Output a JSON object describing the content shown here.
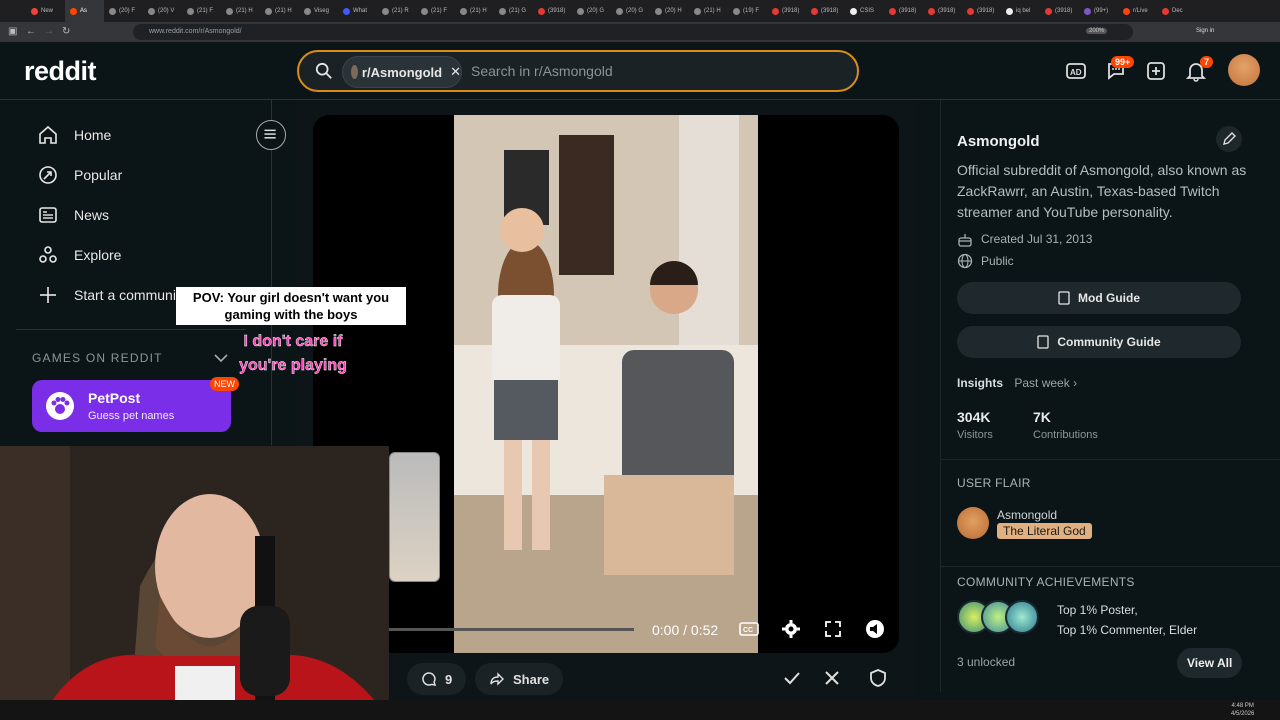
{
  "browser": {
    "tabs": [
      {
        "label": "New",
        "color": "#f44336"
      },
      {
        "label": "As",
        "color": "#ff4500",
        "active": true
      },
      {
        "label": "(20) F",
        "color": "#888"
      },
      {
        "label": "(20) V",
        "color": "#888"
      },
      {
        "label": "(21) F",
        "color": "#888"
      },
      {
        "label": "(21) H",
        "color": "#888"
      },
      {
        "label": "(21) H",
        "color": "#888"
      },
      {
        "label": "Viseg",
        "color": "#888"
      },
      {
        "label": "What",
        "color": "#3d5afe"
      },
      {
        "label": "(21) R",
        "color": "#888"
      },
      {
        "label": "(21) F",
        "color": "#888"
      },
      {
        "label": "(21) H",
        "color": "#888"
      },
      {
        "label": "(21) G",
        "color": "#888"
      },
      {
        "label": "(3918)",
        "color": "#e53935"
      },
      {
        "label": "(20) G",
        "color": "#888"
      },
      {
        "label": "(20) G",
        "color": "#888"
      },
      {
        "label": "(20) H",
        "color": "#888"
      },
      {
        "label": "(21) H",
        "color": "#888"
      },
      {
        "label": "(19) F",
        "color": "#888"
      },
      {
        "label": "(3918)",
        "color": "#e53935"
      },
      {
        "label": "(3918)",
        "color": "#e53935"
      },
      {
        "label": "CSIS",
        "color": "#eee"
      },
      {
        "label": "(3918)",
        "color": "#e53935"
      },
      {
        "label": "(3918)",
        "color": "#e53935"
      },
      {
        "label": "(3918)",
        "color": "#e53935"
      },
      {
        "label": "iq bel",
        "color": "#eee"
      },
      {
        "label": "(3918)",
        "color": "#e53935"
      },
      {
        "label": "(99+)",
        "color": "#7e57c2"
      },
      {
        "label": "r/Live",
        "color": "#ff4500"
      },
      {
        "label": "Dec",
        "color": "#e53935"
      }
    ],
    "url": "www.reddit.com/r/Asmongold/",
    "zoom": "200%",
    "signin": "Sign in"
  },
  "header": {
    "logo": "reddit",
    "search_chip": "r/Asmongold",
    "search_placeholder": "Search in r/Asmongold",
    "chat_badge": "99+",
    "notif_badge": "7"
  },
  "sidebar": {
    "items": [
      {
        "label": "Home"
      },
      {
        "label": "Popular"
      },
      {
        "label": "News"
      },
      {
        "label": "Explore"
      },
      {
        "label": "Start a community"
      }
    ],
    "games_heading": "GAMES ON REDDIT",
    "game": {
      "name": "PetPost",
      "subtitle": "Guess pet names",
      "badge": "NEW"
    }
  },
  "video": {
    "caption_top": "POV: Your girl doesn't want you gaming with the boys",
    "caption_pink": "I don't care if you're playing",
    "timecode": "0:00 / 0:52",
    "progress": 0
  },
  "actions": {
    "comments": "9",
    "share": "Share"
  },
  "community": {
    "name": "Asmongold",
    "description": "Official subreddit of Asmongold, also known as ZackRawrr, an Austin, Texas-based Twitch streamer and YouTube personality.",
    "created": "Created Jul 31, 2013",
    "visibility": "Public",
    "mod_guide": "Mod Guide",
    "community_guide": "Community Guide",
    "insights_label": "Insights",
    "insights_period": "Past week",
    "visitors_value": "304K",
    "visitors_label": "Visitors",
    "contrib_value": "7K",
    "contrib_label": "Contributions",
    "flair_heading": "USER FLAIR",
    "flair_user": "Asmongold",
    "flair_tag": "The Literal God",
    "ach_heading": "COMMUNITY ACHIEVEMENTS",
    "ach_line1": "Top 1% Poster,",
    "ach_line2": "Top 1% Commenter, Elder",
    "unlocked": "3 unlocked",
    "view_all": "View All"
  },
  "taskbar": {
    "time": "4:48 PM",
    "date": "4/5/2026"
  },
  "colors": {
    "accent": "#ff4500",
    "search_border": "#d98c1a",
    "petpost": "#7b2ee8"
  }
}
